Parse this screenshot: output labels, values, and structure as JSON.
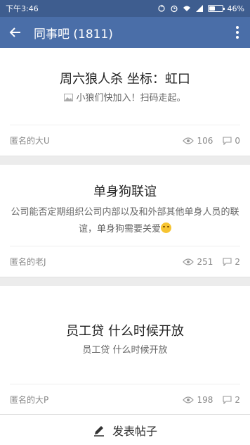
{
  "status": {
    "time": "下午3:46",
    "battery": "46%",
    "battery_level": 0.46
  },
  "appbar": {
    "title": "同事吧 (1811)"
  },
  "posts": [
    {
      "title": "周六狼人杀 坐标：虹口",
      "body": "小狼们快加入！扫码走起。",
      "author": "匿名的大U",
      "views": "106",
      "comments": "0"
    },
    {
      "title": "单身狗联谊",
      "body": "公司能否定期组织公司内部以及和外部其他单身人员的联谊，单身狗需要关爱",
      "author": "匿名的老J",
      "views": "251",
      "comments": "2"
    },
    {
      "title": "员工贷 什么时候开放",
      "body": "员工贷 什么时候开放",
      "author": "匿名的大P",
      "views": "198",
      "comments": "2"
    }
  ],
  "bottom": {
    "post_label": "发表帖子"
  },
  "icons": {
    "back": "back-arrow-icon",
    "more": "more-vert-icon",
    "image": "image-icon",
    "views": "eye-icon",
    "comments": "comment-icon",
    "edit": "pencil-icon"
  }
}
